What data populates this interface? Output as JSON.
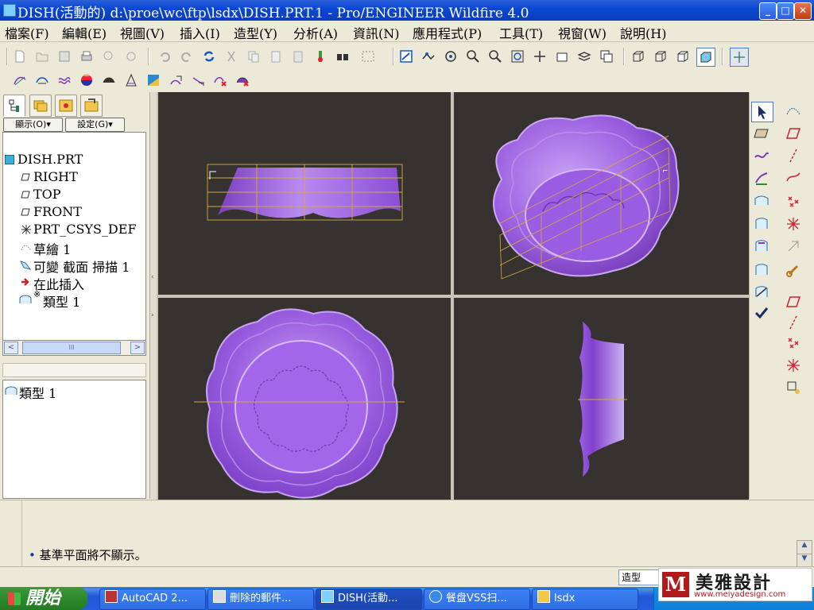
{
  "window": {
    "title": "DISH(活動的) d:\\proe\\wc\\ftp\\lsdx\\DISH.PRT.1 - Pro/ENGINEER Wildfire 4.0",
    "min": "_",
    "max": "□",
    "close": "✕"
  },
  "menu": [
    "檔案(F)",
    "編輯(E)",
    "視圖(V)",
    "插入(I)",
    "造型(Y)",
    "分析(A)",
    "資訊(N)",
    "應用程式(P)",
    "工具(T)",
    "視窗(W)",
    "說明(H)"
  ],
  "leftpanel": {
    "show_btn": "顯示(O)▾",
    "settings_btn": "設定(G)▾",
    "tree": [
      {
        "label": "DISH.PRT",
        "icon": "part-icon"
      },
      {
        "label": "RIGHT",
        "icon": "datum-plane-icon"
      },
      {
        "label": "TOP",
        "icon": "datum-plane-icon"
      },
      {
        "label": "FRONT",
        "icon": "datum-plane-icon"
      },
      {
        "label": "PRT_CSYS_DEF",
        "icon": "csys-icon"
      },
      {
        "label": "草繪 1",
        "icon": "sketch-icon"
      },
      {
        "label": "可變 截面 掃描 1",
        "icon": "sweep-icon"
      },
      {
        "label": "在此插入",
        "icon": "insert-arrow-icon"
      },
      {
        "label": "類型 1",
        "icon": "style-icon"
      }
    ],
    "style_mark": "※",
    "hscroll_thumb": "III",
    "layer_item": "類型 1"
  },
  "message": {
    "bullet": "•",
    "text": "基準平面將不顯示。"
  },
  "statusbar": {
    "filter": "造型"
  },
  "taskbar": {
    "start": "開始",
    "tasks": [
      {
        "label": "AutoCAD 2...",
        "icon": "autocad-icon"
      },
      {
        "label": "刪除的郵件...",
        "icon": "mail-icon"
      },
      {
        "label": "DISH(活動...",
        "icon": "proe-icon",
        "active": true
      },
      {
        "label": "餐盘VSS扫...",
        "icon": "ie-icon"
      },
      {
        "label": "lsdx",
        "icon": "folder-icon"
      }
    ]
  },
  "logo": {
    "text": "美雅設計",
    "url": "www.meiyadesign.com"
  },
  "colors": {
    "viewport_bg": "#35322f",
    "model": "#9b5fe0",
    "datum": "#d4a93b",
    "titlebar": "#0a48d4"
  }
}
